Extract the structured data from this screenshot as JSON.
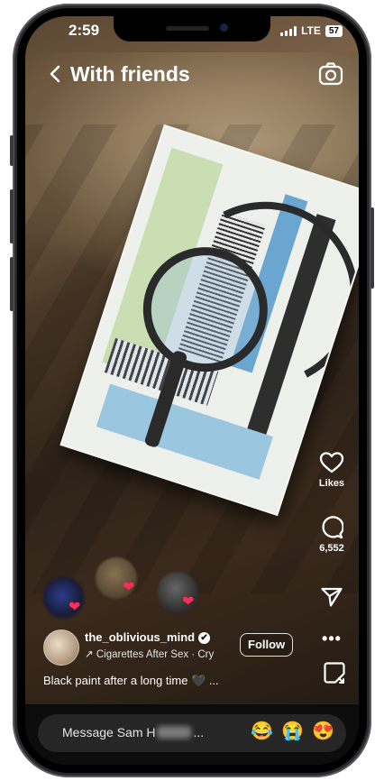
{
  "status": {
    "time": "2:59",
    "network": "LTE",
    "battery": "57"
  },
  "header": {
    "title": "With friends"
  },
  "rail": {
    "likes_label": "Likes",
    "comments_count": "6,552"
  },
  "post": {
    "username": "the_oblivious_mind",
    "song": "Cigarettes After Sex · Cry",
    "follow_label": "Follow",
    "caption": "Black paint after a long time 🖤 ..."
  },
  "composer": {
    "placeholder_prefix": "Message Sam H",
    "placeholder_suffix": "...",
    "emojis": [
      "😂",
      "😭",
      "😍"
    ]
  },
  "icons": [
    "back-chevron-icon",
    "camera-icon",
    "heart-icon",
    "comment-icon",
    "send-icon",
    "more-icon",
    "sticker-reply-icon",
    "verified-icon",
    "music-arrow-icon"
  ],
  "colors": {
    "heart_accent": "#ff2d55",
    "composer_bg": "#262626"
  }
}
